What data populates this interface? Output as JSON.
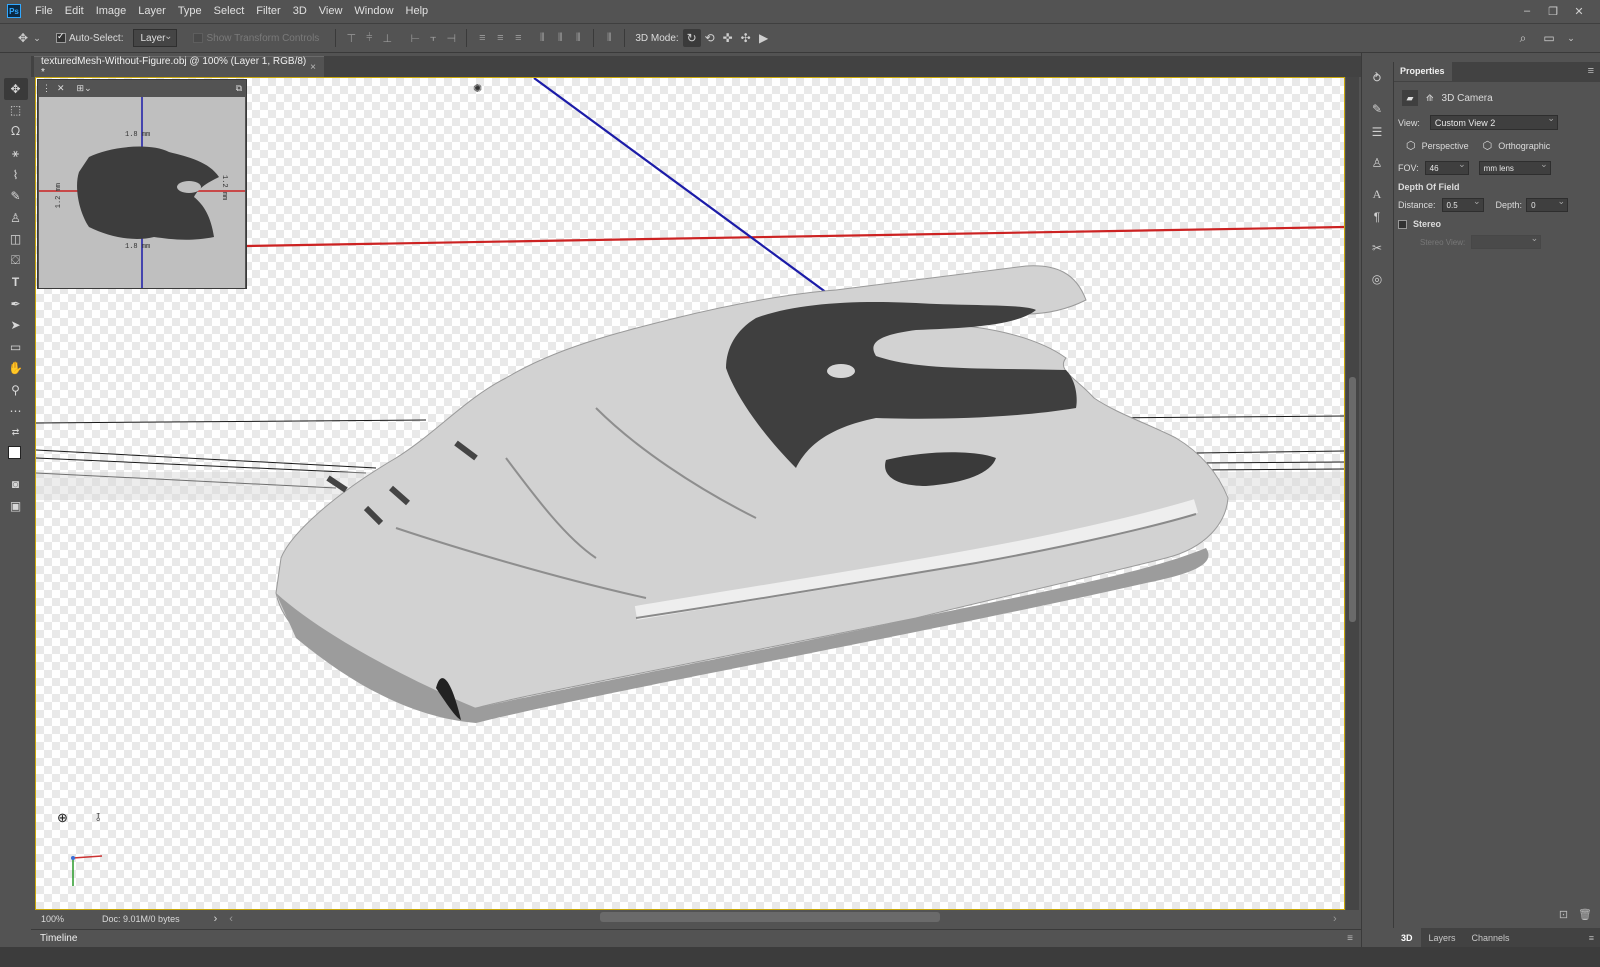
{
  "app": {
    "logo": "Ps"
  },
  "menu": [
    "File",
    "Edit",
    "Image",
    "Layer",
    "Type",
    "Select",
    "Filter",
    "3D",
    "View",
    "Window",
    "Help"
  ],
  "window_controls": {
    "minimize": "–",
    "restore": "❐",
    "close": "✕"
  },
  "options": {
    "auto_select_label": "Auto-Select:",
    "auto_select_checked": true,
    "auto_select_target": "Layer",
    "show_transform_label": "Show Transform Controls",
    "mode_3d_label": "3D Mode:"
  },
  "document": {
    "tab_title": "texturedMesh-Without-Figure.obj @ 100% (Layer 1, RGB/8) *",
    "close": "×"
  },
  "navigator": {
    "dim_top": "1.8",
    "dim_bottom": "1.8",
    "dim_right": "1.2",
    "dim_left": "1.2",
    "unit": "mm"
  },
  "status": {
    "zoom": "100%",
    "doc_info": "Doc: 9.01M/0 bytes",
    "arrow": "›",
    "left_arrow": "‹",
    "right_arrow": "›"
  },
  "timeline": {
    "label": "Timeline",
    "menu": "≡"
  },
  "properties": {
    "tab_label": "Properties",
    "menu": "≡",
    "section_title": "3D Camera",
    "view_label": "View:",
    "view_value": "Custom View 2",
    "perspective_label": "Perspective",
    "orthographic_label": "Orthographic",
    "fov_label": "FOV:",
    "fov_value": "46",
    "lens_value": "mm lens",
    "dof_title": "Depth Of Field",
    "distance_label": "Distance:",
    "distance_value": "0.5",
    "depth_label": "Depth:",
    "depth_value": "0",
    "stereo_label": "Stereo",
    "stereo_checked": false,
    "stereo_view_label": "Stereo View:"
  },
  "panel_tabs": [
    "3D",
    "Layers",
    "Channels"
  ],
  "colors": {
    "accent_x_axis": "#cc2222",
    "accent_z_axis": "#1c1ca8",
    "canvas_border": "#c9a80a",
    "ui_bg": "#535353"
  }
}
